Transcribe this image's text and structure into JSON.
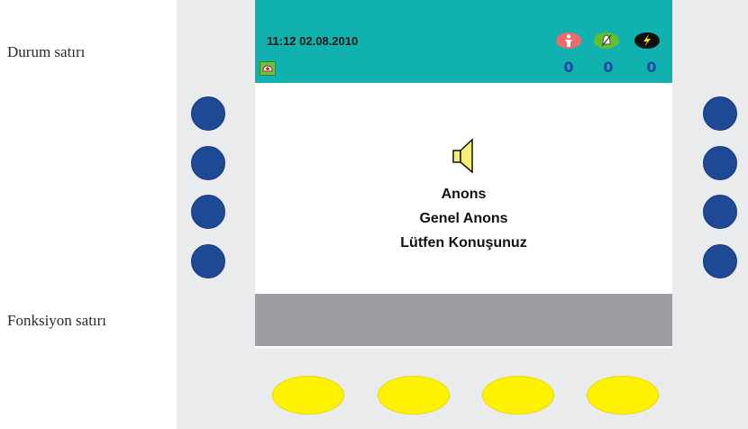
{
  "labels": {
    "status_row": "Durum satırı",
    "function_row": "Fonksiyon satırı"
  },
  "status_bar": {
    "datetime": "11:12 02.08.2010",
    "indicators": [
      {
        "icon": "person-alarm-icon",
        "color": "#ef6a6c",
        "count": "0"
      },
      {
        "icon": "bell-fault-icon",
        "color": "#65bd2f",
        "count": "0"
      },
      {
        "icon": "lightning-icon",
        "color": "#0f0f0f",
        "count": "0"
      }
    ],
    "left_icon": "nurse-cap-icon"
  },
  "message": {
    "icon": "speaker-icon",
    "line1": "Anons",
    "line2": "Genel Anons",
    "line3": "Lütfen Konuşunuz"
  },
  "colors": {
    "status_bar": "#10b1ae",
    "side_buttons": "#1e4a95",
    "function_buttons": "#fff200",
    "function_bar": "#9c9ea2",
    "panel": "#eaebed"
  }
}
